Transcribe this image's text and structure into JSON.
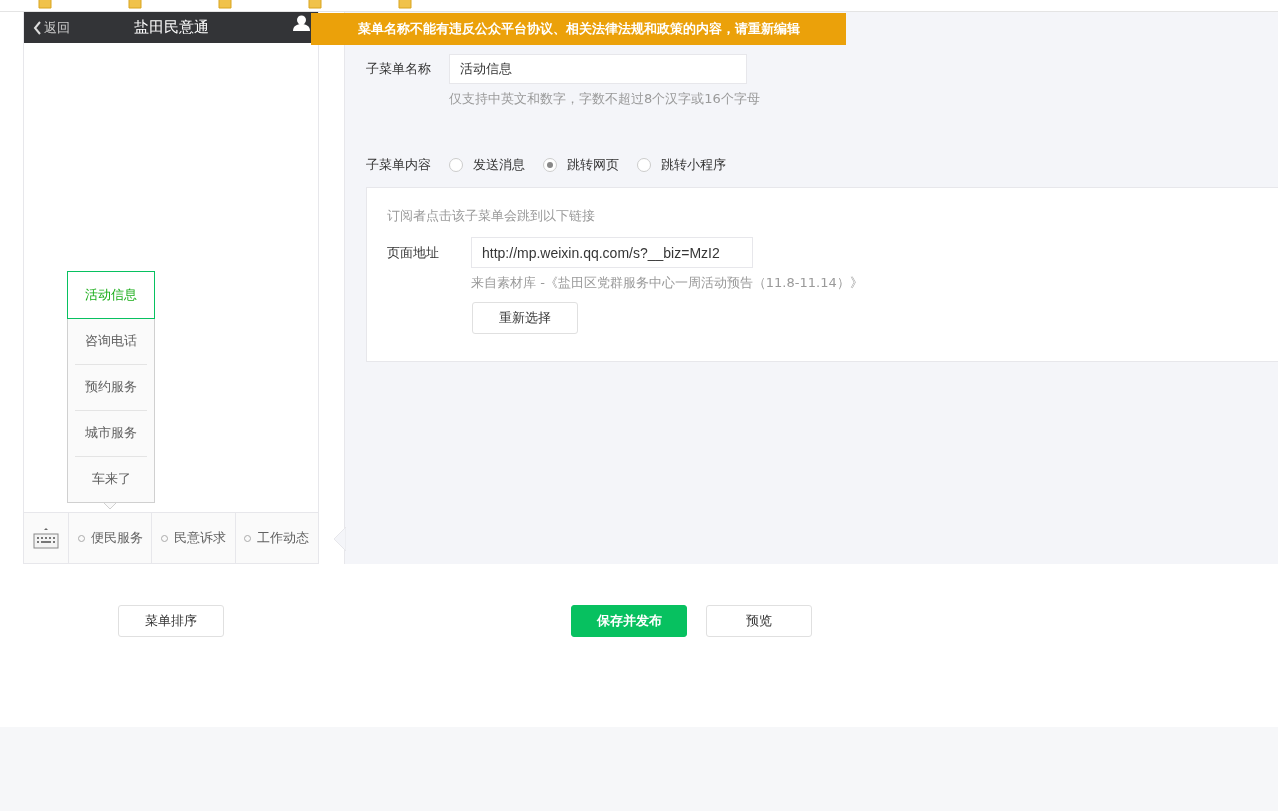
{
  "phone": {
    "back": "返回",
    "title": "盐田民意通",
    "submenu": [
      {
        "label": "活动信息",
        "selected": true
      },
      {
        "label": "咨询电话",
        "selected": false
      },
      {
        "label": "预约服务",
        "selected": false
      },
      {
        "label": "城市服务",
        "selected": false
      },
      {
        "label": "车来了",
        "selected": false
      }
    ],
    "menu": [
      "便民服务",
      "民意诉求",
      "工作动态"
    ]
  },
  "notice": "菜单名称不能有违反公众平台协议、相关法律法规和政策的内容，请重新编辑",
  "editor": {
    "name_label": "子菜单名称",
    "name_value": "活动信息",
    "name_hint": "仅支持中英文和数字，字数不超过8个汉字或16个字母",
    "content_label": "子菜单内容",
    "options": [
      {
        "label": "发送消息",
        "selected": false
      },
      {
        "label": "跳转网页",
        "selected": true
      },
      {
        "label": "跳转小程序",
        "selected": false
      }
    ],
    "link": {
      "hint": "订阅者点击该子菜单会跳到以下链接",
      "url_label": "页面地址",
      "url_value": "http://mp.weixin.qq.com/s?__biz=MzI2",
      "source": "来自素材库 -《盐田区党群服务中心一周活动预告（11.8-11.14）》",
      "reselect": "重新选择"
    }
  },
  "actions": {
    "sort": "菜单排序",
    "publish": "保存并发布",
    "preview": "预览"
  }
}
